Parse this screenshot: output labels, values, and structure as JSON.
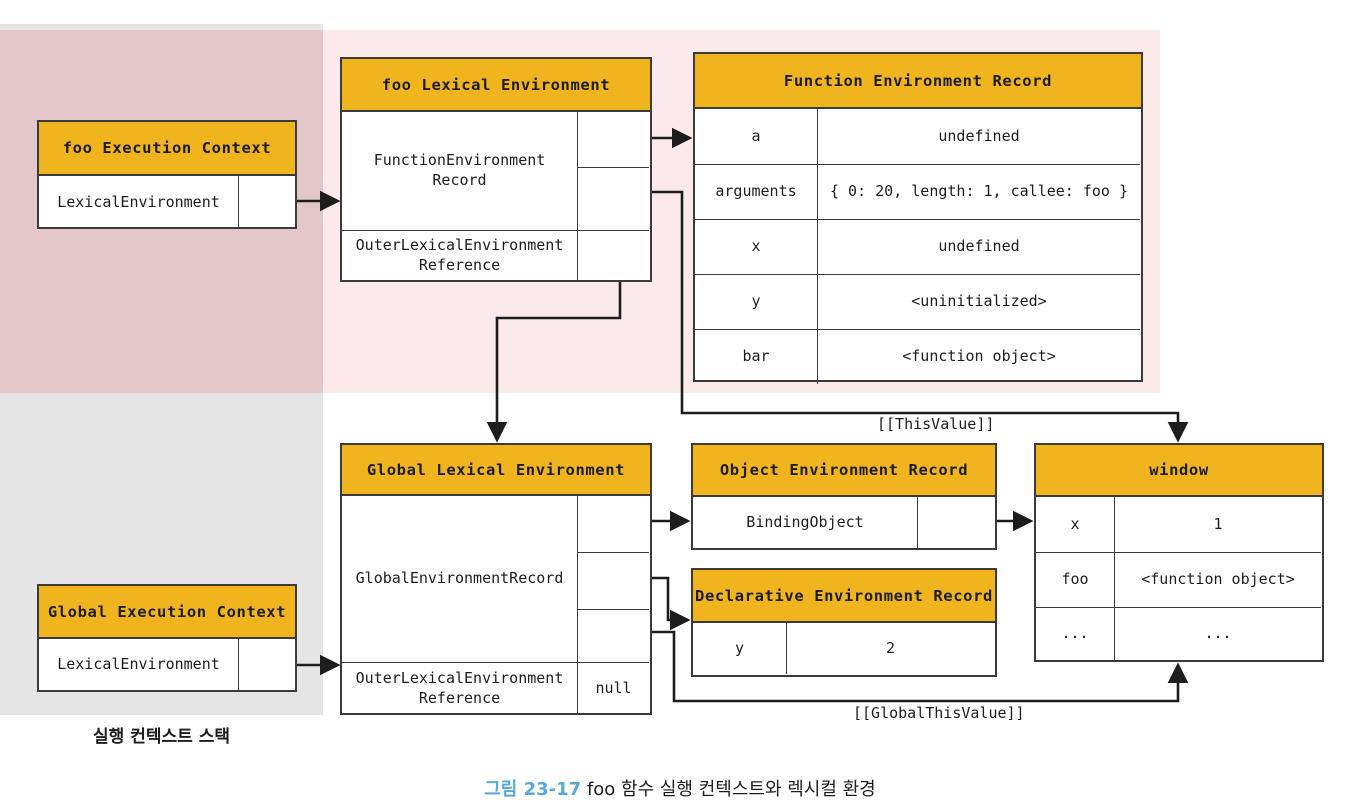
{
  "colors": {
    "header_gold": "#f0b51e",
    "region_exec_stack": "#e6e5e5",
    "region_foo": "#e2c8c8",
    "region_exec_pink": "#fce9e9",
    "stroke": "#3b3b3b",
    "caption_accent": "#5aa7dd"
  },
  "caption": {
    "number": "그림 23-17",
    "text": "foo 함수 실행 컨텍스트와 렉시컬 환경"
  },
  "stack_label": "실행 컨텍스트 스택",
  "foo_execution_context": {
    "title": "foo Execution Context",
    "rows": [
      {
        "key": "LexicalEnvironment",
        "value": ""
      }
    ]
  },
  "global_execution_context": {
    "title": "Global Execution Context",
    "rows": [
      {
        "key": "LexicalEnvironment",
        "value": ""
      }
    ]
  },
  "foo_lexical_environment": {
    "title": "foo Lexical Environment",
    "rows": [
      {
        "key": "FunctionEnvironment\nRecord",
        "value": ""
      },
      {
        "key": "OuterLexicalEnvironment\nReference",
        "value": ""
      }
    ]
  },
  "function_environment_record": {
    "title": "Function Environment Record",
    "rows": [
      {
        "key": "a",
        "value": "undefined"
      },
      {
        "key": "arguments",
        "value": "{ 0: 20, length: 1, callee: foo }"
      },
      {
        "key": "x",
        "value": "undefined"
      },
      {
        "key": "y",
        "value": "<uninitialized>"
      },
      {
        "key": "bar",
        "value": "<function object>"
      }
    ]
  },
  "global_lexical_environment": {
    "title": "Global Lexical Environment",
    "rows": [
      {
        "key": "GlobalEnvironmentRecord",
        "value": ""
      },
      {
        "key": "OuterLexicalEnvironment\nReference",
        "value": "null"
      }
    ]
  },
  "object_environment_record": {
    "title": "Object Environment Record",
    "rows": [
      {
        "key": "BindingObject",
        "value": ""
      }
    ]
  },
  "declarative_environment_record": {
    "title": "Declarative Environment Record",
    "rows": [
      {
        "key": "y",
        "value": "2"
      }
    ]
  },
  "window_object": {
    "title": "window",
    "rows": [
      {
        "key": "x",
        "value": "1"
      },
      {
        "key": "foo",
        "value": "<function object>"
      },
      {
        "key": "...",
        "value": "..."
      }
    ]
  },
  "edge_labels": {
    "this_value": "[[ThisValue]]",
    "global_this_value": "[[GlobalThisValue]]"
  }
}
